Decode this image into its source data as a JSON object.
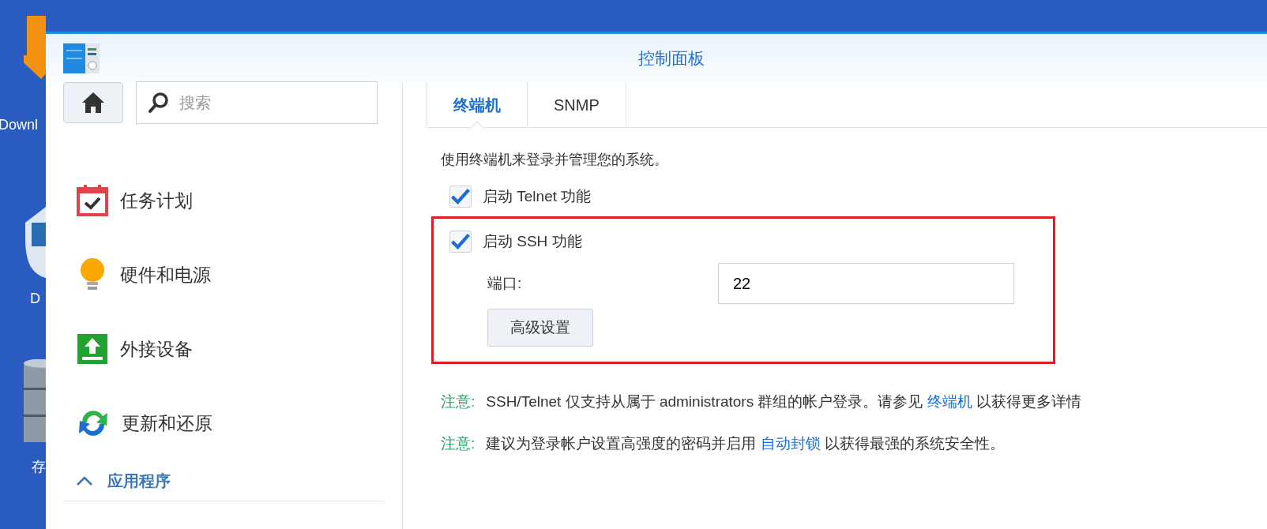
{
  "desktop": {
    "labels": [
      "Downl",
      "D",
      "存"
    ]
  },
  "window": {
    "title": "控制面板"
  },
  "sidebar": {
    "search": {
      "placeholder": "搜索"
    },
    "items": [
      {
        "label": "任务计划",
        "selected": false
      },
      {
        "label": "硬件和电源",
        "selected": false
      },
      {
        "label": "外接设备",
        "selected": false
      },
      {
        "label": "更新和还原",
        "selected": false
      }
    ],
    "section": {
      "label": "应用程序",
      "expanded": true
    }
  },
  "tabs": [
    {
      "label": "终端机",
      "selected": true
    },
    {
      "label": "SNMP",
      "selected": false
    }
  ],
  "description": "使用终端机来登录并管理您的系统。",
  "options": [
    {
      "label": "启动 Telnet 功能",
      "checked": true,
      "highlighted": false
    },
    {
      "label": "启动 SSH 功能",
      "checked": true,
      "highlighted": true,
      "port_label": "端口:",
      "port": "22",
      "button": "高级设置"
    }
  ],
  "notes": [
    {
      "prefix": "注意:",
      "before": "SSH/Telnet 仅支持从属于 administrators 群组的帐户登录。请参见",
      "link": "终端机",
      "after": "以获得更多详情"
    },
    {
      "prefix": "注意:",
      "before": "建议为登录帐户设置高强度的密码并启用",
      "link": "自动封锁",
      "after": "以获得最强的系统安全性。"
    }
  ]
}
